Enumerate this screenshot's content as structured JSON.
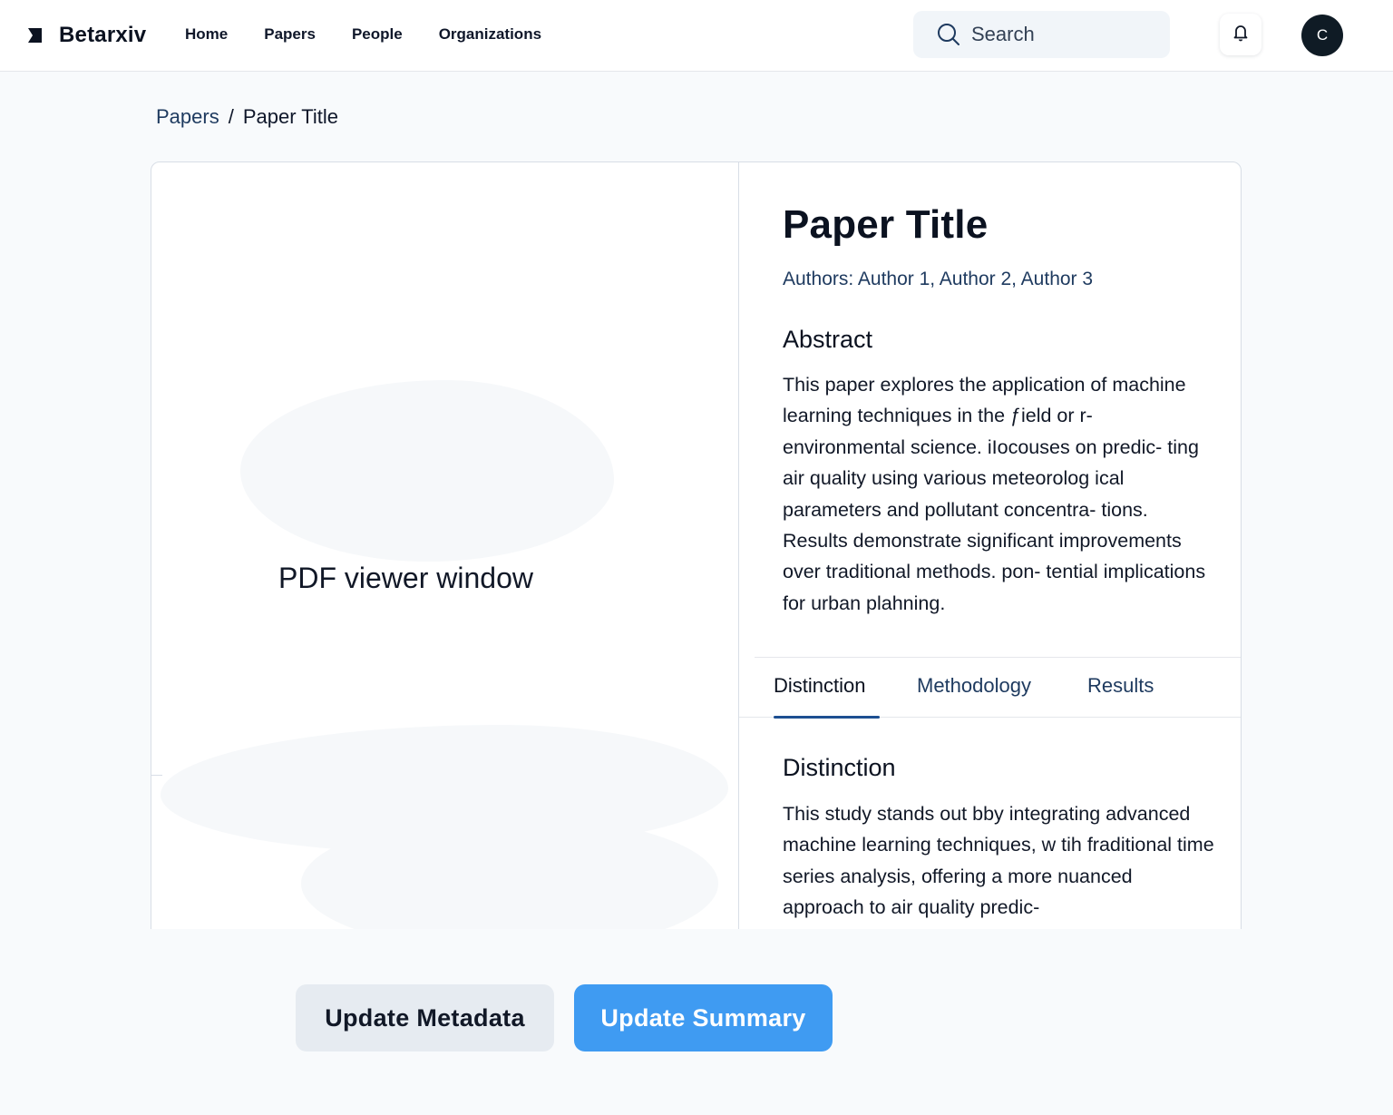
{
  "app": {
    "name": "Betarxiv"
  },
  "nav": {
    "items": [
      {
        "label": "Home"
      },
      {
        "label": "Papers"
      },
      {
        "label": "People"
      },
      {
        "label": "Organizations"
      }
    ]
  },
  "search": {
    "placeholder": "Search"
  },
  "user": {
    "avatar_initial": "C"
  },
  "breadcrumb": {
    "parent": "Papers",
    "separator": "/",
    "current": "Paper Title"
  },
  "pdf_viewer": {
    "label": "PDF viewer window"
  },
  "paper": {
    "title": "Paper Title",
    "authors": "Authors: Author 1, Author 2, Author 3",
    "abstract_heading": "Abstract",
    "abstract": "This paper explores the application of machine learning techniques in the ƒield or r- environmental science. iIocouses on predic- ting air quality using various meteorolog ical parameters and pollutant concentra- tions. Results demonstrate significant improvements over traditional methods. pon- tential implications for urban plahning."
  },
  "tabs": [
    {
      "label": "Distinction",
      "active": true
    },
    {
      "label": "Methodology",
      "active": false
    },
    {
      "label": "Results",
      "active": false
    }
  ],
  "section": {
    "heading": "Distinction",
    "text": "This study stands out bby integrating advanced machine learning techniques, w tih fraditional time series analysis, offering a more nuanced approach to air quality predic-"
  },
  "actions": {
    "update_metadata": "Update Metadata",
    "update_summary": "Update Summary"
  },
  "colors": {
    "primary_button": "#3f9bf2",
    "secondary_button": "#e6ebf1",
    "tab_underline": "#1d4f91",
    "link": "#1e3a5f"
  }
}
